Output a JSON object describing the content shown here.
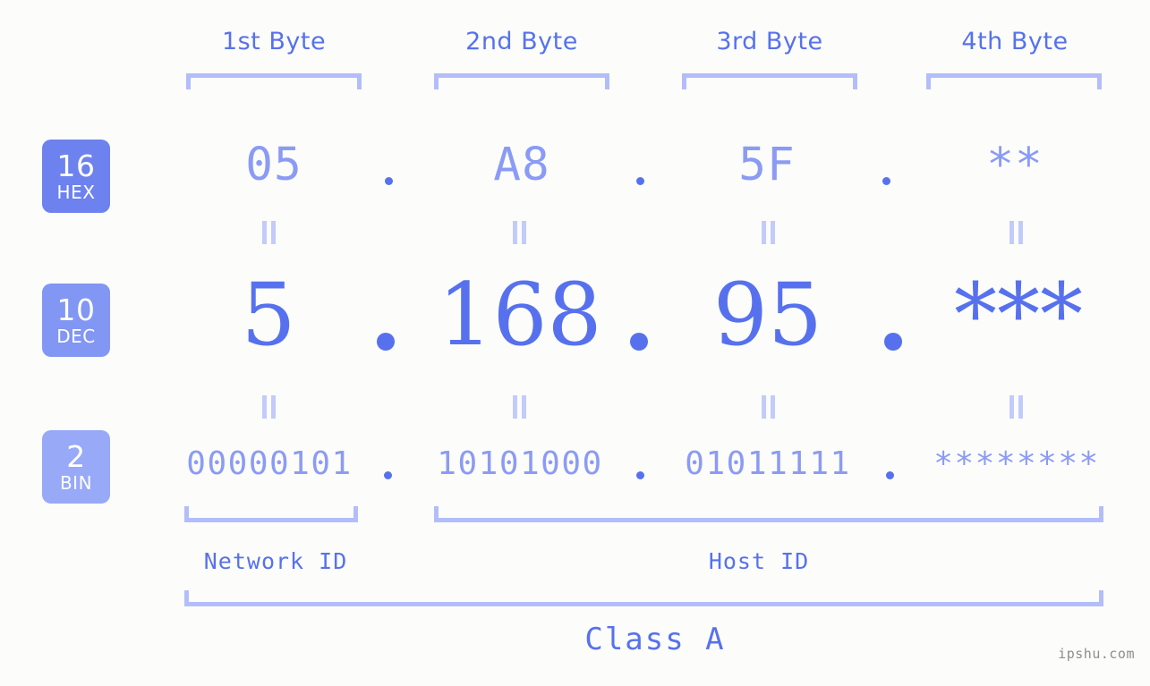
{
  "page": {
    "background_color": "#fcfdfa",
    "accent_color": "#5771ee",
    "muted_color": "#8b9bf5",
    "bracket_color": "#b3bdfb"
  },
  "byte_headers": [
    {
      "label": "1st Byte"
    },
    {
      "label": "2nd Byte"
    },
    {
      "label": "3rd Byte"
    },
    {
      "label": "4th Byte"
    }
  ],
  "radix_badges": [
    {
      "num": "16",
      "tag": "HEX",
      "color": "#6d82ee"
    },
    {
      "num": "10",
      "tag": "DEC",
      "color": "#8296f3"
    },
    {
      "num": "2",
      "tag": "BIN",
      "color": "#97a9f7"
    }
  ],
  "rows": {
    "hex": {
      "radix": "16",
      "values": [
        "05",
        "A8",
        "5F",
        "**"
      ],
      "separator": "."
    },
    "dec": {
      "radix": "10",
      "values": [
        "5",
        "168",
        "95",
        "***"
      ],
      "separator": "."
    },
    "bin": {
      "radix": "2",
      "values": [
        "00000101",
        "10101000",
        "01011111",
        "********"
      ],
      "separator": "."
    }
  },
  "connectors": {
    "symbol": "=",
    "count_per_gap": 4
  },
  "segments": {
    "network_id": {
      "label": "Network ID"
    },
    "host_id": {
      "label": "Host ID"
    },
    "class": {
      "label": "Class A"
    }
  },
  "watermark": {
    "text": "ipshu.com"
  }
}
